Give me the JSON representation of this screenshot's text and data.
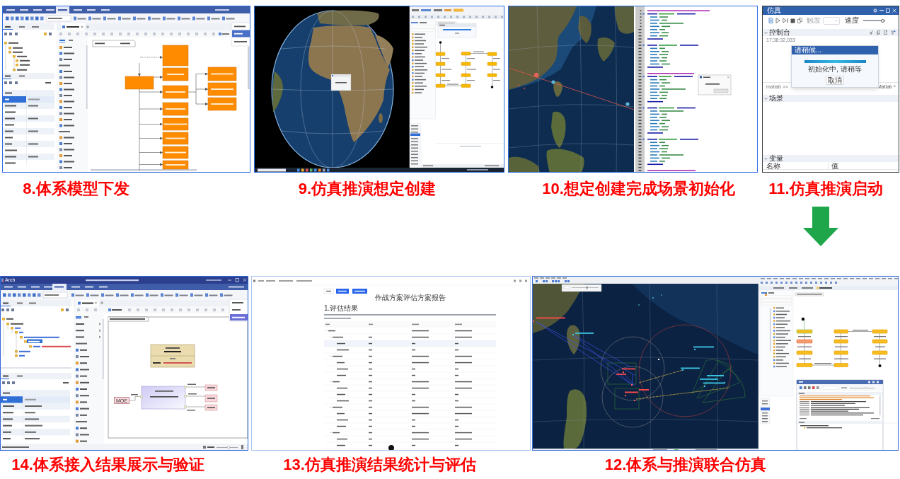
{
  "top_panels": [
    {
      "kind": "model_dispatch",
      "caption": "8.体系模型下发"
    },
    {
      "kind": "scenario_create",
      "caption": "9.仿真推演想定创建"
    },
    {
      "kind": "scene_init",
      "caption": "10.想定创建完成场景初始化"
    },
    {
      "kind": "sim_start",
      "caption": "11.仿真推演启动",
      "window": {
        "title": "仿真",
        "trigger": {
          "label": "触发",
          "disabled": true
        },
        "speed": {
          "label": "速度",
          "level": 0.95
        },
        "console": {
          "title": "控制台",
          "expanded": true,
          "log_time": "17:38:32,033"
        },
        "dialog": {
          "title": "请稍候...",
          "level": 1,
          "message": "初始化中, 请稍等",
          "cancel": "取消"
        },
        "prompt": "matlab >>",
        "engine": "Matlab",
        "sections": [
          {
            "title": "场景",
            "expanded": true
          },
          {
            "title": "变量",
            "expanded": true,
            "columns": [
              "名称",
              "值"
            ]
          }
        ]
      }
    }
  ],
  "bottom_panels": [
    {
      "kind": "result_verify",
      "caption": "14.体系接入结果展示与验证",
      "app_name": "Arch",
      "node_label": "MOE"
    },
    {
      "kind": "evaluation_report",
      "caption": "13.仿真推演结果统计与评估",
      "title": "作战方案评估方案报告",
      "section_heading": "1.评估结果"
    },
    {
      "kind": "joint_sim",
      "caption": "12.体系与推演联合仿真"
    }
  ]
}
